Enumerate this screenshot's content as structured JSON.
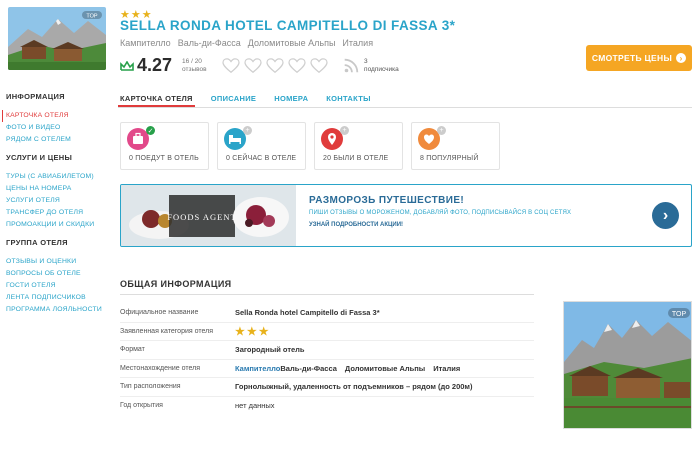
{
  "header": {
    "stars": "★★★",
    "title": "SELLA RONDA HOTEL CAMPITELLO DI FASSA 3*",
    "locations": [
      "Кампителло",
      "Валь-ди-Фасса",
      "Доломитовые Альпы",
      "Италия"
    ],
    "rating": "4.27",
    "reviews_count": "16 / 20",
    "reviews_label": "отзывов",
    "subscribers_count": "3",
    "subscribers_label": "подписчика",
    "prices_button": "СМОТРЕТЬ ЦЕНЫ",
    "thumb_badge": "TOP",
    "colors": {
      "accent": "#2aa4c9",
      "orange": "#f5a623",
      "rating_green": "#27a04a"
    }
  },
  "sidebar": {
    "groups": [
      {
        "title": "ИНФОРМАЦИЯ",
        "items": [
          "КАРТОЧКА ОТЕЛЯ",
          "ФОТО И ВИДЕО",
          "РЯДОМ С ОТЕЛЕМ"
        ]
      },
      {
        "title": "УСЛУГИ И ЦЕНЫ",
        "items": [
          "ТУРЫ (С АВИАБИЛЕТОМ)",
          "ЦЕНЫ НА НОМЕРА",
          "УСЛУГИ ОТЕЛЯ",
          "ТРАНСФЕР ДО ОТЕЛЯ",
          "ПРОМОАКЦИИ И СКИДКИ"
        ]
      },
      {
        "title": "ГРУППА ОТЕЛЯ",
        "items": [
          "ОТЗЫВЫ И ОЦЕНКИ",
          "ВОПРОСЫ ОБ ОТЕЛЕ",
          "ГОСТИ ОТЕЛЯ",
          "ЛЕНТА ПОДПИСЧИКОВ",
          "ПРОГРАММА ЛОЯЛЬНОСТИ"
        ]
      }
    ]
  },
  "tabs": [
    "КАРТОЧКА ОТЕЛЯ",
    "ОПИСАНИЕ",
    "НОМЕРА",
    "КОНТАКТЫ"
  ],
  "cards": [
    {
      "text": "0 ПОЕДУТ В ОТЕЛЬ",
      "icon": "suitcase-icon",
      "color": "#e2498a"
    },
    {
      "text": "0 СЕЙЧАС В ОТЕЛЕ",
      "icon": "bed-icon",
      "color": "#2aa4c9"
    },
    {
      "text": "20 БЫЛИ В ОТЕЛЕ",
      "icon": "map-pin-icon",
      "color": "#e03b3b"
    },
    {
      "text": "8 ПОПУЛЯРНЫЙ",
      "icon": "heart-icon",
      "color": "#f08a3c"
    }
  ],
  "promo": {
    "brand": "FOODS AGENT",
    "title": "РАЗМОРОЗЬ ПУТЕШЕСТВИЕ!",
    "subtitle": "ПИШИ ОТЗЫВЫ О МОРОЖЕНОМ, ДОБАВЛЯЙ ФОТО, ПОДПИСЫВАЙСЯ В СОЦ СЕТЯХ",
    "link": "УЗНАЙ ПОДРОБНОСТИ АКЦИИ!"
  },
  "general": {
    "title": "ОБЩАЯ ИНФОРМАЦИЯ",
    "rows": {
      "official_label": "Официальное название",
      "official_value": "Sella Ronda hotel Campitello di Fassa 3*",
      "category_label": "Заявленная категория отеля",
      "category_value": "★★★",
      "format_label": "Формат",
      "format_value": "Загородный отель",
      "location_label": "Местонахождение отеля",
      "location_values": [
        "Кампителло",
        "Валь-ди-Фасса",
        "Доломитовые Альпы",
        "Италия"
      ],
      "placement_label": "Тип расположения",
      "placement_value": "Горнолыжный, удаленность от подъемников – рядом (до 200м)",
      "year_label": "Год открытия",
      "year_value": "нет данных"
    }
  }
}
